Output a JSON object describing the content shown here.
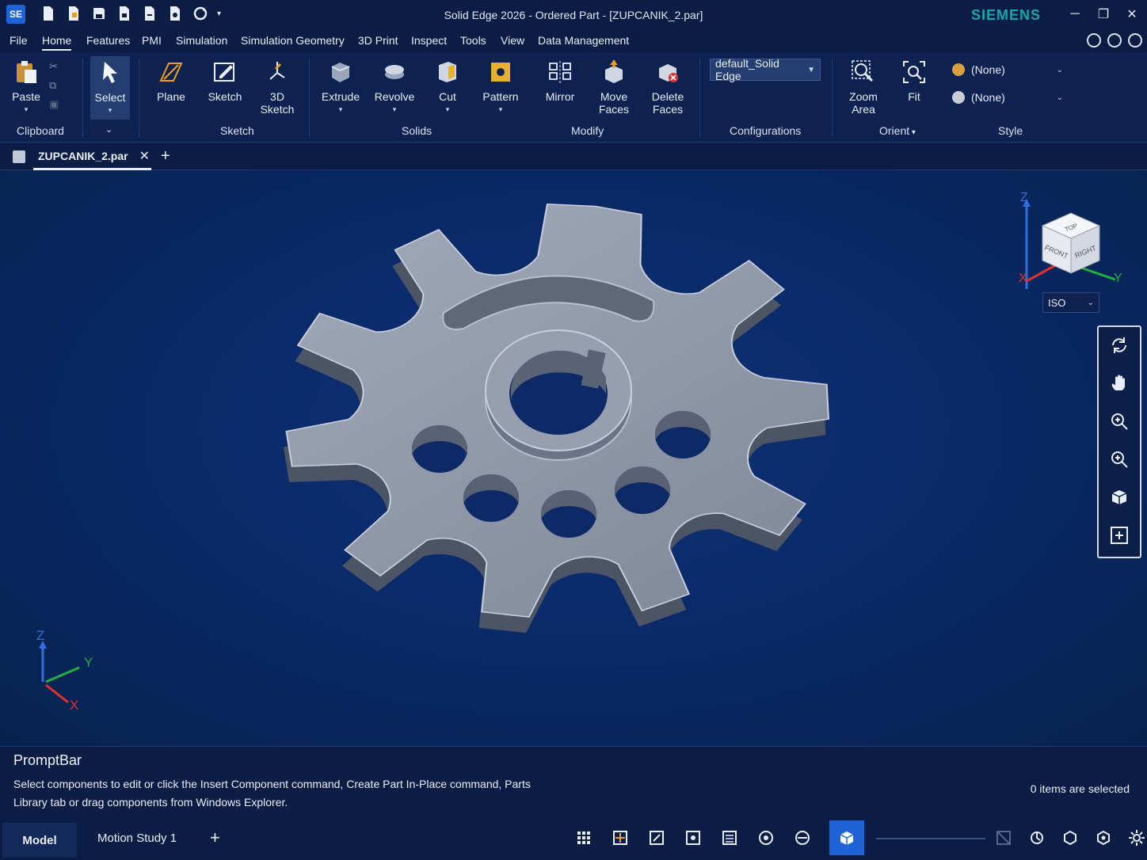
{
  "window": {
    "app_logo": "SE",
    "title": "Solid Edge 2026 - Ordered Part - [ZUPCANIK_2.par]",
    "brand": "SIEMENS",
    "buttons": [
      "minimize-icon",
      "restore-icon",
      "close-icon"
    ]
  },
  "quick_access": [
    "new-icon",
    "open-icon",
    "save-icon",
    "print-icon",
    "undo-icon",
    "redo-icon",
    "refresh-icon"
  ],
  "menu": {
    "items": [
      "File",
      "Home",
      "Features",
      "PMI",
      "Simulation",
      "Simulation Geometry",
      "3D Print",
      "Inspect",
      "Tools",
      "View",
      "Data Management"
    ],
    "active": "Home"
  },
  "ribbon": {
    "clipboard": {
      "paste": "Paste",
      "group": "Clipboard"
    },
    "select": {
      "label": "Select"
    },
    "sketch": {
      "plane": "Plane",
      "sketch": "Sketch",
      "sketch3d": "3D Sketch",
      "group": "Sketch"
    },
    "solids": {
      "extrude": "Extrude",
      "revolve": "Revolve",
      "cut": "Cut",
      "pattern": "Pattern",
      "group": "Solids"
    },
    "modify": {
      "mirror": "Mirror",
      "move_faces": "Move Faces",
      "delete_faces": "Delete Faces",
      "group": "Modify"
    },
    "configurations": {
      "value": "default_Solid Edge",
      "group": "Configurations"
    },
    "orient": {
      "zoom_area": "Zoom Area",
      "fit": "Fit",
      "group": "Orient"
    },
    "style": {
      "face_style": "(None)",
      "view_style": "(None)",
      "group": "Style"
    }
  },
  "document_tab": {
    "name": "ZUPCANIK_2.par",
    "close": "✕",
    "add": "+"
  },
  "viewport": {
    "axis_labels": {
      "x": "X",
      "y": "Y",
      "z": "Z"
    },
    "viewcube_faces": {
      "top": "TOP",
      "front": "FRONT",
      "right": "RIGHT"
    },
    "view_orientation": "ISO",
    "nav_tools": [
      "rotate-icon",
      "pan-hand-icon",
      "zoom-icon",
      "zoom-area-icon",
      "view-cube-icon",
      "fit-icon"
    ]
  },
  "promptbar": {
    "title": "PromptBar",
    "message": "Select components to edit or click the Insert Component command, Create Part In-Place command, Parts Library tab or drag components from Windows Explorer.",
    "selection_status": "0 items are selected"
  },
  "statusbar": {
    "tabs": [
      "Model",
      "Motion Study 1"
    ],
    "active_tab": "Model",
    "add_tab": "+"
  },
  "colors": {
    "background": "#0a1f4a",
    "ribbon": "#0d2250",
    "accent": "#1f63d8",
    "brand": "#14a8a8",
    "part": "#8d95a6"
  }
}
